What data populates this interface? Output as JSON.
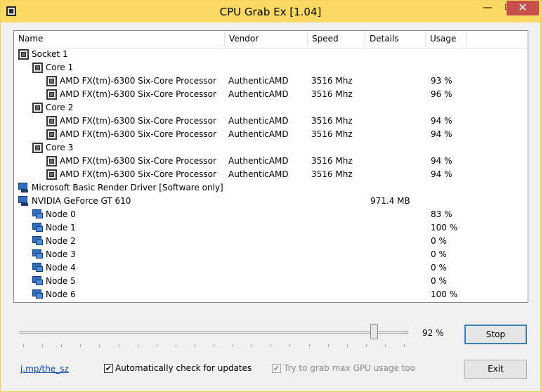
{
  "window": {
    "title": "CPU Grab Ex [1.04]",
    "controls": {
      "minimize": "—",
      "maximize": "☐",
      "close": "✕"
    }
  },
  "columns": [
    "Name",
    "Vendor",
    "Speed",
    "Details",
    "Usage"
  ],
  "rows": [
    {
      "indent": 0,
      "icon": "cpu-chip-icon",
      "name": "Socket 1",
      "vendor": "",
      "speed": "",
      "details": "",
      "usage": ""
    },
    {
      "indent": 1,
      "icon": "cpu-chip-icon",
      "name": "Core 1",
      "vendor": "",
      "speed": "",
      "details": "",
      "usage": ""
    },
    {
      "indent": 2,
      "icon": "cpu-chip-icon",
      "name": "AMD FX(tm)-6300 Six-Core Processor",
      "vendor": "AuthenticAMD",
      "speed": "3516 Mhz",
      "details": "",
      "usage": "93 %"
    },
    {
      "indent": 2,
      "icon": "cpu-chip-icon",
      "name": "AMD FX(tm)-6300 Six-Core Processor",
      "vendor": "AuthenticAMD",
      "speed": "3516 Mhz",
      "details": "",
      "usage": "96 %"
    },
    {
      "indent": 1,
      "icon": "cpu-chip-icon",
      "name": "Core 2",
      "vendor": "",
      "speed": "",
      "details": "",
      "usage": ""
    },
    {
      "indent": 2,
      "icon": "cpu-chip-icon",
      "name": "AMD FX(tm)-6300 Six-Core Processor",
      "vendor": "AuthenticAMD",
      "speed": "3516 Mhz",
      "details": "",
      "usage": "94 %"
    },
    {
      "indent": 2,
      "icon": "cpu-chip-icon",
      "name": "AMD FX(tm)-6300 Six-Core Processor",
      "vendor": "AuthenticAMD",
      "speed": "3516 Mhz",
      "details": "",
      "usage": "94 %"
    },
    {
      "indent": 1,
      "icon": "cpu-chip-icon",
      "name": "Core 3",
      "vendor": "",
      "speed": "",
      "details": "",
      "usage": ""
    },
    {
      "indent": 2,
      "icon": "cpu-chip-icon",
      "name": "AMD FX(tm)-6300 Six-Core Processor",
      "vendor": "AuthenticAMD",
      "speed": "3516 Mhz",
      "details": "",
      "usage": "94 %"
    },
    {
      "indent": 2,
      "icon": "cpu-chip-icon",
      "name": "AMD FX(tm)-6300 Six-Core Processor",
      "vendor": "AuthenticAMD",
      "speed": "3516 Mhz",
      "details": "",
      "usage": "94 %"
    },
    {
      "indent": 0,
      "icon": "monitor-icon",
      "name": "Microsoft Basic Render Driver [Software only]",
      "vendor": "",
      "speed": "",
      "details": "",
      "usage": ""
    },
    {
      "indent": 0,
      "icon": "monitor-icon",
      "name": "NVIDIA GeForce GT 610",
      "vendor": "",
      "speed": "",
      "details": "971.4 MB",
      "usage": ""
    },
    {
      "indent": 1,
      "icon": "display-node-icon",
      "name": "Node 0",
      "vendor": "",
      "speed": "",
      "details": "",
      "usage": "83 %"
    },
    {
      "indent": 1,
      "icon": "display-node-icon",
      "name": "Node 1",
      "vendor": "",
      "speed": "",
      "details": "",
      "usage": "100 %"
    },
    {
      "indent": 1,
      "icon": "display-node-icon",
      "name": "Node 2",
      "vendor": "",
      "speed": "",
      "details": "",
      "usage": "0 %"
    },
    {
      "indent": 1,
      "icon": "display-node-icon",
      "name": "Node 3",
      "vendor": "",
      "speed": "",
      "details": "",
      "usage": "0 %"
    },
    {
      "indent": 1,
      "icon": "display-node-icon",
      "name": "Node 4",
      "vendor": "",
      "speed": "",
      "details": "",
      "usage": "0 %"
    },
    {
      "indent": 1,
      "icon": "display-node-icon",
      "name": "Node 5",
      "vendor": "",
      "speed": "",
      "details": "",
      "usage": "0 %"
    },
    {
      "indent": 1,
      "icon": "display-node-icon",
      "name": "Node 6",
      "vendor": "",
      "speed": "",
      "details": "",
      "usage": "100 %"
    }
  ],
  "controls": {
    "slider_value": 0.92,
    "slider_percent_label": "92 %",
    "stop_label": "Stop",
    "exit_label": "Exit",
    "link_label": "j.mp/the_sz",
    "auto_update_label": "Automatically check for updates",
    "auto_update_checked": true,
    "gpu_grab_label": "Try to grab max GPU usage too",
    "gpu_grab_checked": true,
    "gpu_grab_enabled": false
  },
  "colors": {
    "titlebar": "#fcd962",
    "close_button": "#c7514a",
    "link": "#0645ad",
    "default_button_border": "#3c7fb1"
  }
}
